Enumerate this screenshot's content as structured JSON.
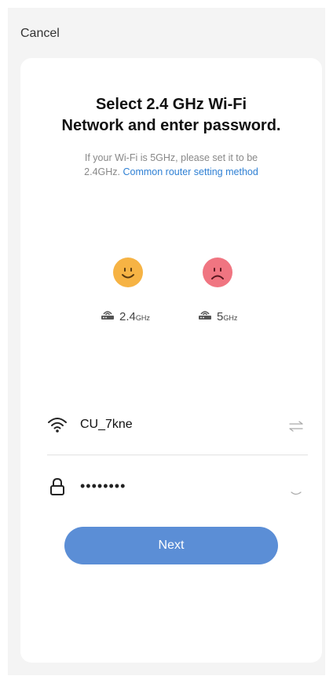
{
  "header": {
    "cancel_label": "Cancel"
  },
  "card": {
    "title_line1": "Select 2.4 GHz Wi-Fi",
    "title_line2": "Network and enter password.",
    "subtitle_line1": "If your Wi-Fi is 5GHz, please set it to be",
    "subtitle_line2_prefix": "2.4GHz. ",
    "subtitle_link": "Common router setting method"
  },
  "bands": [
    {
      "value": "2.4",
      "unit": "GHz",
      "status": "supported",
      "face_icon": "smiley-face-icon",
      "color": "#f6b344"
    },
    {
      "value": "5",
      "unit": "GHz",
      "status": "not-supported",
      "face_icon": "sad-face-icon",
      "color": "#f07581"
    }
  ],
  "network": {
    "ssid": "CU_7kne",
    "password_masked": "••••••••"
  },
  "buttons": {
    "next_label": "Next"
  },
  "colors": {
    "accent": "#5b8ed6",
    "link": "#2f80d4",
    "page_background": "#f4f4f4"
  }
}
